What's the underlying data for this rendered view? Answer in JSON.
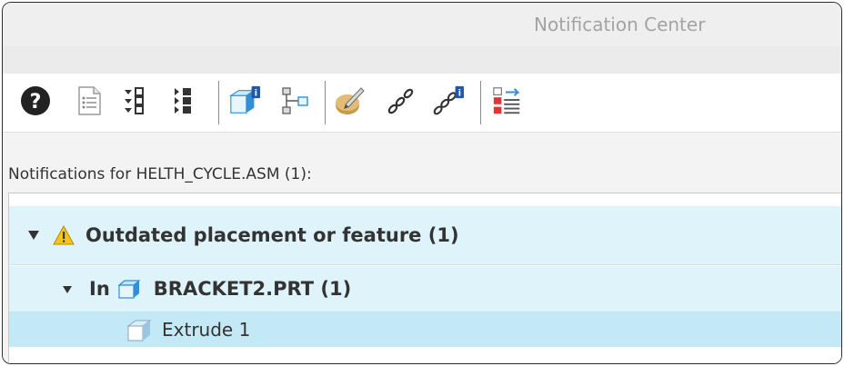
{
  "window": {
    "title": "Notification Center"
  },
  "toolbar": {
    "buttons": [
      {
        "icon": "help-icon"
      },
      {
        "icon": "document-list-icon"
      },
      {
        "icon": "expand-all-icon"
      },
      {
        "icon": "collapse-all-icon"
      },
      {
        "icon": "model-info-icon"
      },
      {
        "icon": "model-tree-icon"
      },
      {
        "icon": "edit-definition-icon"
      },
      {
        "icon": "reference-links-icon"
      },
      {
        "icon": "reference-info-icon"
      },
      {
        "icon": "update-notifications-icon"
      }
    ]
  },
  "notifications": {
    "header": "Notifications for HELTH_CYCLE.ASM (1):",
    "group": {
      "label": "Outdated placement or feature (1)"
    },
    "subgroup": {
      "prefix": "In",
      "label": "BRACKET2.PRT (1)"
    },
    "feature": {
      "label": "Extrude 1"
    }
  },
  "colors": {
    "row_highlight": "#dff3fa",
    "row_selected": "#c3e8f6",
    "warning": "#f5c518",
    "accent_blue": "#2f8fd8"
  }
}
